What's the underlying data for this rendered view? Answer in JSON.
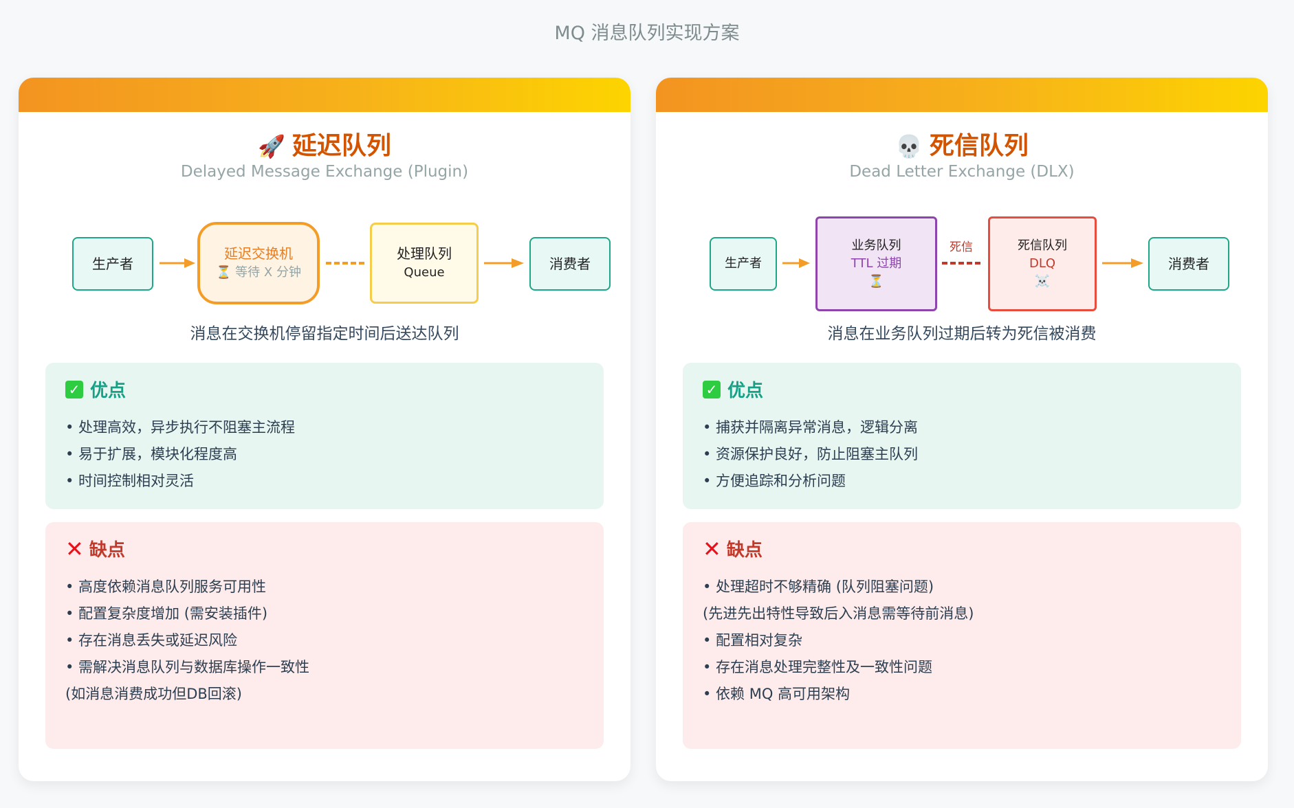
{
  "header": {
    "subtitle": "MQ 消息队列实现方案"
  },
  "left": {
    "title_emoji": "🚀",
    "title": "延迟队列",
    "subtitle": "Delayed Message Exchange (Plugin)",
    "nodes": {
      "producer": "生产者",
      "exchange_title": "延迟交换机",
      "exchange_wait": "⏳ 等待 X 分钟",
      "queue_title": "处理队列",
      "queue_sub": "Queue",
      "consumer": "消费者"
    },
    "caption": "消息在交换机停留指定时间后送达队列",
    "pros_title": "优点",
    "pros": [
      "• 处理高效，异步执行不阻塞主流程",
      "• 易于扩展，模块化程度高",
      "• 时间控制相对灵活"
    ],
    "cons_title": "缺点",
    "cons": [
      "• 高度依赖消息队列服务可用性",
      "• 配置复杂度增加 (需安装插件)",
      "• 存在消息丢失或延迟风险",
      "• 需解决消息队列与数据库操作一致性",
      "(如消息消费成功但DB回滚)"
    ]
  },
  "right": {
    "title_emoji": "💀",
    "title": "死信队列",
    "subtitle": "Dead Letter Exchange (DLX)",
    "nodes": {
      "producer": "生产者",
      "biz_title": "业务队列",
      "biz_ttl": "TTL 过期",
      "biz_icon": "⏳",
      "dead_label": "死信",
      "dlq_title": "死信队列",
      "dlq_sub": "DLQ",
      "dlq_icon": "☠️",
      "consumer": "消费者"
    },
    "caption": "消息在业务队列过期后转为死信被消费",
    "pros_title": "优点",
    "pros": [
      "• 捕获并隔离异常消息，逻辑分离",
      "• 资源保护良好，防止阻塞主队列",
      "• 方便追踪和分析问题"
    ],
    "cons_title": "缺点",
    "cons": [
      "• 处理超时不够精确 (队列阻塞问题)",
      "(先进先出特性导致后入消息需等待前消息)",
      "• 配置相对复杂",
      "• 存在消息处理完整性及一致性问题",
      "• 依赖 MQ 高可用架构"
    ]
  },
  "colors": {
    "accent_orange": "#f39421",
    "accent_yellow": "#fdd400",
    "title_orange": "#d35400",
    "pros_bg": "#e8f6f2",
    "cons_bg": "#fdeceb",
    "arrow": "#f39c27",
    "dead_dash": "#c0392b"
  },
  "icons": {
    "pros": "check-box-icon",
    "cons": "cross-icon"
  }
}
